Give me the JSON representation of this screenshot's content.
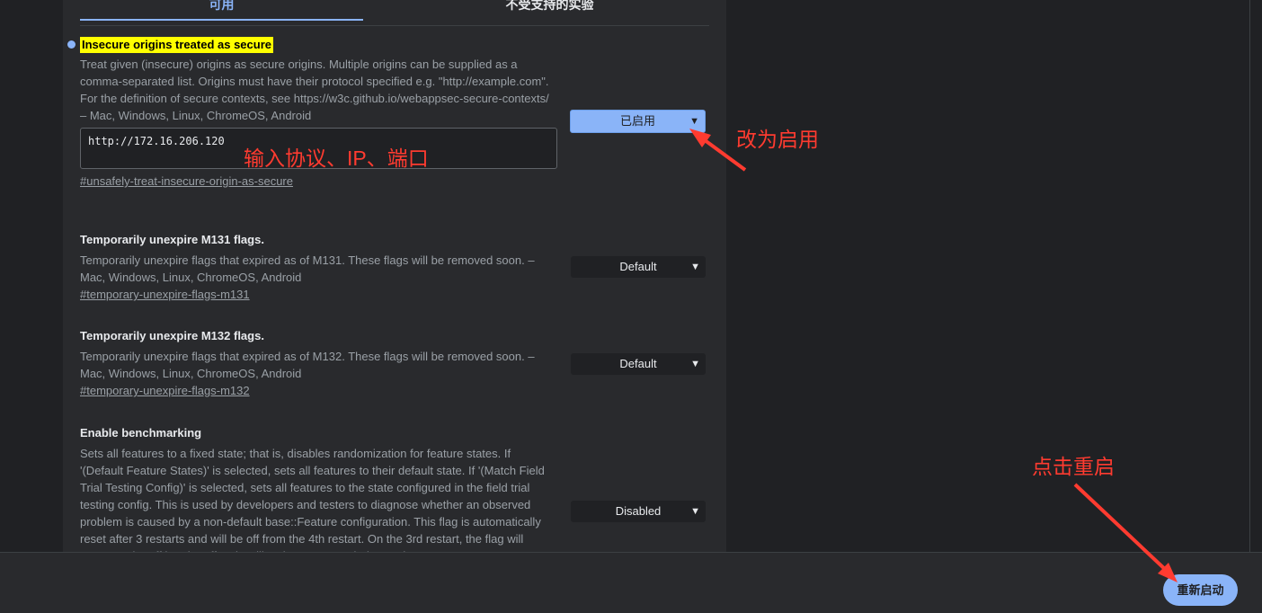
{
  "tabs": {
    "available": "可用",
    "unavailable": "不受支持的实验"
  },
  "flags": [
    {
      "title": "Insecure origins treated as secure",
      "description": "Treat given (insecure) origins as secure origins. Multiple origins can be supplied as a comma-separated list. Origins must have their protocol specified e.g. \"http://example.com\". For the definition of secure contexts, see https://w3c.github.io/webappsec-secure-contexts/ – Mac, Windows, Linux, ChromeOS, Android",
      "value": "http://172.16.206.120",
      "link": "#unsafely-treat-insecure-origin-as-secure",
      "select": "已启用"
    },
    {
      "title": "Temporarily unexpire M131 flags.",
      "description": "Temporarily unexpire flags that expired as of M131. These flags will be removed soon. – Mac, Windows, Linux, ChromeOS, Android",
      "link": "#temporary-unexpire-flags-m131",
      "select": "Default"
    },
    {
      "title": "Temporarily unexpire M132 flags.",
      "description": "Temporarily unexpire flags that expired as of M132. These flags will be removed soon. – Mac, Windows, Linux, ChromeOS, Android",
      "link": "#temporary-unexpire-flags-m132",
      "select": "Default"
    },
    {
      "title": "Enable benchmarking",
      "description": "Sets all features to a fixed state; that is, disables randomization for feature states. If '(Default Feature States)' is selected, sets all features to their default state. If '(Match Field Trial Testing Config)' is selected, sets all features to the state configured in the field trial testing config. This is used by developers and testers to diagnose whether an observed problem is caused by a non-default base::Feature configuration. This flag is automatically reset after 3 restarts and will be off from the 4th restart. On the 3rd restart, the flag will appear to be off but the effect is still active. – Mac, Windows, Linux",
      "select": "Disabled"
    }
  ],
  "annotations": {
    "enable": "改为启用",
    "input": "输入协议、IP、端口",
    "restart": "点击重启"
  },
  "footer": {
    "restart_label": "重新启动"
  },
  "icons": {
    "select_arrow": "chevron-down-icon",
    "modified_marker": "blue-dot"
  },
  "colors": {
    "accent": "#8ab4f8",
    "highlight": "#ffff00",
    "annotation": "#ff3b30",
    "background": "#202124",
    "panel": "#292a2d"
  }
}
